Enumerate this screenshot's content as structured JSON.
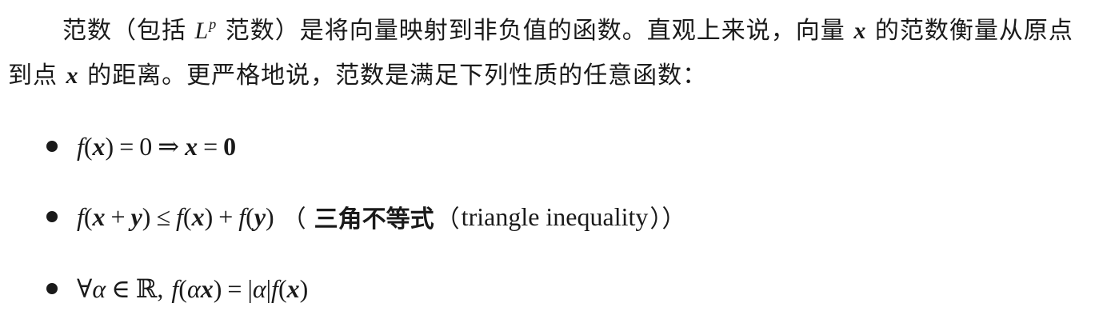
{
  "paragraph": {
    "seg1": "范数（包括 ",
    "lp_base": "L",
    "lp_sup": "p",
    "seg2": " 范数）是将向量映射到非负值的函数。直观上来说，向量 ",
    "x_symbol": "x",
    "seg3": " 的范数衡量从原点到点 ",
    "seg4": " 的距离。更严格地说，范数是满足下列性质的任意函数："
  },
  "properties": [
    {
      "f": "f",
      "lparen": "(",
      "x": "x",
      "rparen": ")",
      "eq": "=",
      "zero": "0",
      "implies": "⇒",
      "x2": "x",
      "eq2": "=",
      "zero_vec": "0"
    },
    {
      "f": "f",
      "lparen": "(",
      "x": "x",
      "plus": "+",
      "y": "y",
      "rparen": ")",
      "leq": "≤",
      "f2": "f",
      "lparen2": "(",
      "x2": "x",
      "rparen2": ")",
      "plus2": "+",
      "f3": "f",
      "lparen3": "(",
      "y2": "y",
      "rparen3": ")",
      "note_open": "（",
      "note_cn": "三角不等式",
      "note_open2": "（",
      "note_en": "triangle inequality",
      "note_close": "））"
    },
    {
      "forall": "∀",
      "alpha": "α",
      "in": "∈",
      "reals": "ℝ,",
      "f": "f",
      "lparen": "(",
      "alpha2": "α",
      "x": "x",
      "rparen": ")",
      "eq": "=",
      "abs_open": "|",
      "alpha3": "α",
      "abs_close": "|",
      "f2": "f",
      "lparen2": "(",
      "x2": "x",
      "rparen2": ")"
    }
  ]
}
